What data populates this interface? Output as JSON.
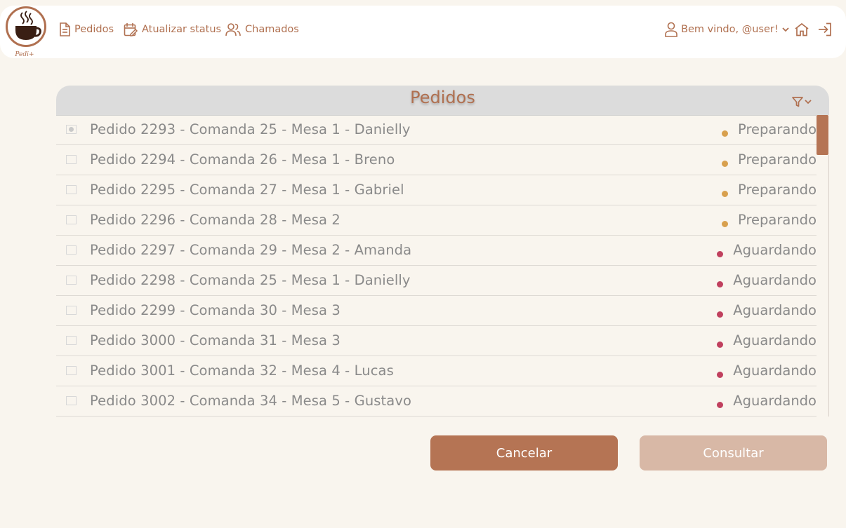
{
  "brand": {
    "logo_text": "Pedi+"
  },
  "nav": {
    "links": [
      {
        "label": "Pedidos",
        "icon": "document-icon"
      },
      {
        "label": "Atualizar status",
        "icon": "calendar-edit-icon"
      },
      {
        "label": "Chamados",
        "icon": "users-icon"
      }
    ],
    "greeting": "Bem vindo, @user!",
    "home_icon": "home-icon",
    "logout_icon": "logout-icon"
  },
  "panel": {
    "title": "Pedidos",
    "filter_icon": "filter-icon"
  },
  "orders": [
    {
      "label": "Pedido 2293 - Comanda 25 - Mesa 1 - Danielly",
      "status": "Preparando",
      "selected": true
    },
    {
      "label": "Pedido 2294 - Comanda 26 - Mesa 1 - Breno",
      "status": "Preparando",
      "selected": false
    },
    {
      "label": "Pedido 2295 - Comanda 27 - Mesa 1 - Gabriel",
      "status": "Preparando",
      "selected": false
    },
    {
      "label": "Pedido 2296 - Comanda 28 - Mesa 2",
      "status": "Preparando",
      "selected": false
    },
    {
      "label": "Pedido 2297 - Comanda 29 - Mesa 2 - Amanda",
      "status": "Aguardando",
      "selected": false
    },
    {
      "label": "Pedido 2298 - Comanda 25 - Mesa 1 - Danielly",
      "status": "Aguardando",
      "selected": false
    },
    {
      "label": "Pedido 2299 - Comanda 30 - Mesa 3",
      "status": "Aguardando",
      "selected": false
    },
    {
      "label": "Pedido 3000 - Comanda 31 - Mesa 3",
      "status": "Aguardando",
      "selected": false
    },
    {
      "label": "Pedido 3001 - Comanda 32 - Mesa 4 - Lucas",
      "status": "Aguardando",
      "selected": false
    },
    {
      "label": "Pedido 3002 - Comanda 34 - Mesa 5 - Gustavo",
      "status": "Aguardando",
      "selected": false
    }
  ],
  "status_colors": {
    "Preparando": "#d8a04e",
    "Aguardando": "#c0405e"
  },
  "buttons": {
    "cancel": "Cancelar",
    "consult": "Consultar"
  },
  "colors": {
    "accent": "#b57454",
    "accent_light": "#d8b8a6",
    "background": "#f9f5ee",
    "header_gray": "#dcdcdc"
  }
}
